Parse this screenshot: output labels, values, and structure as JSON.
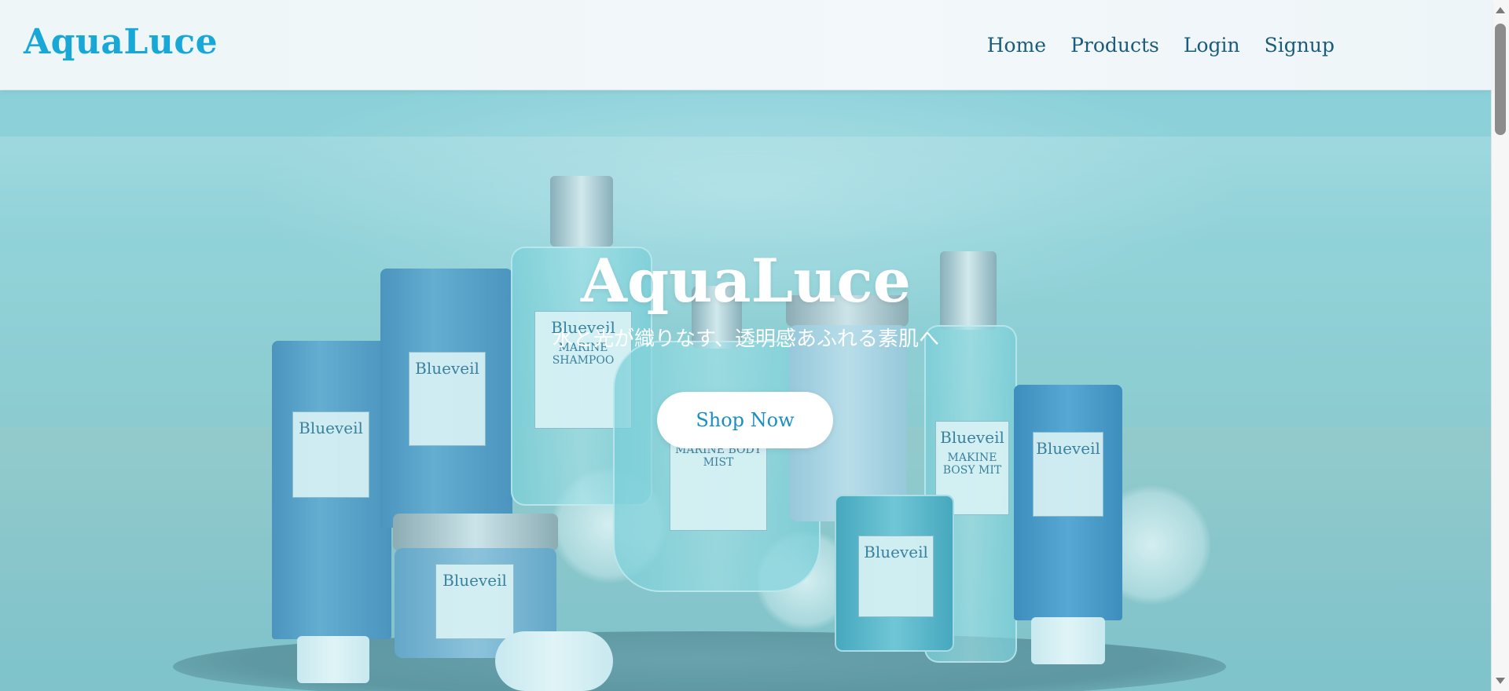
{
  "header": {
    "logo": "AquaLuce",
    "nav": [
      {
        "label": "Home"
      },
      {
        "label": "Products"
      },
      {
        "label": "Login"
      },
      {
        "label": "Signup"
      }
    ]
  },
  "hero": {
    "title": "AquaLuce",
    "subtitle": "水と光が織りなす、透明感あふれる素肌へ",
    "cta_label": "Shop Now",
    "product_labels": {
      "brand": "Blueveil",
      "shampoo": "MARINE SHAMPOO",
      "body_mist_center": "MARINE BODY MIST",
      "body_mist_right": "MAKINE BOSY MIT"
    }
  },
  "colors": {
    "brand": "#18a8d8",
    "nav_text": "#1b5c7a",
    "cta_text": "#1a8fc2",
    "hero_bg": "#8fcbce"
  }
}
